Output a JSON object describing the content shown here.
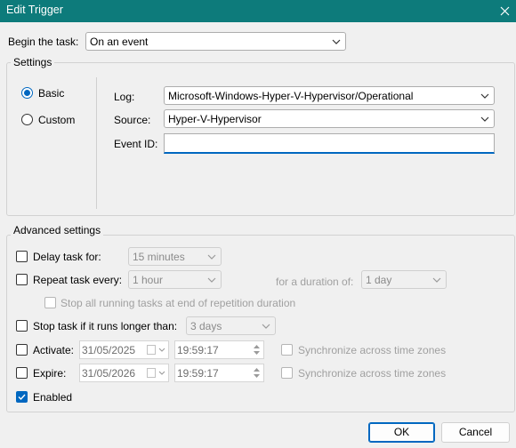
{
  "window": {
    "title": "Edit Trigger"
  },
  "begin": {
    "label": "Begin the task:",
    "value": "On an event"
  },
  "settings": {
    "title": "Settings",
    "radio_basic": "Basic",
    "radio_custom": "Custom",
    "log_label": "Log:",
    "log_value": "Microsoft-Windows-Hyper-V-Hypervisor/Operational",
    "source_label": "Source:",
    "source_value": "Hyper-V-Hypervisor",
    "eventid_label": "Event ID:",
    "eventid_value": ""
  },
  "advanced": {
    "title": "Advanced settings",
    "delay_label": "Delay task for:",
    "delay_value": "15 minutes",
    "repeat_label": "Repeat task every:",
    "repeat_value": "1 hour",
    "duration_label": "for a duration of:",
    "duration_value": "1 day",
    "stop_running_label": "Stop all running tasks at end of repetition duration",
    "stop_longer_label": "Stop task if it runs longer than:",
    "stop_longer_value": "3 days",
    "activate_label": "Activate:",
    "activate_date": "31/05/2025",
    "activate_time": "19:59:17",
    "activate_sync": "Synchronize across time zones",
    "expire_label": "Expire:",
    "expire_date": "31/05/2026",
    "expire_time": "19:59:17",
    "expire_sync": "Synchronize across time zones",
    "enabled_label": "Enabled"
  },
  "buttons": {
    "ok": "OK",
    "cancel": "Cancel"
  },
  "colors": {
    "titlebar": "#0d7b7b",
    "accent": "#0067c0"
  },
  "icons": {
    "close": "close-icon",
    "dropdown": "chevron-down-icon",
    "check": "checkmark-icon",
    "spin": "spin-arrows-icon",
    "calendar": "calendar-icon"
  }
}
